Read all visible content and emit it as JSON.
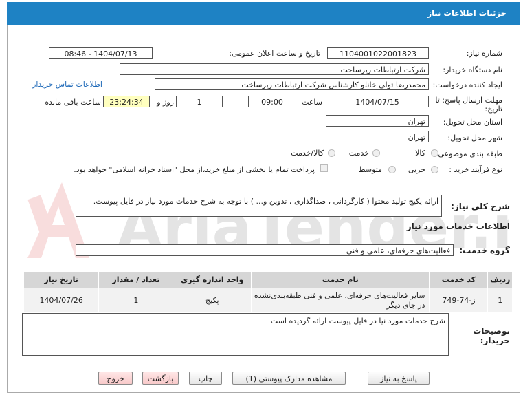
{
  "window_title": "جزئیات اطلاعات نیاز",
  "form": {
    "need_number_label": "شماره نیاز:",
    "need_number": "1104001022001823",
    "announce_label": "تاریخ و ساعت اعلان عمومی:",
    "announce_value": "1404/07/13 - 08:46",
    "buyer_org_label": "نام دستگاه خریدار:",
    "buyer_org": "شرکت ارتباطات زیرساخت",
    "creator_label": "ایجاد کننده درخواست:",
    "creator": "محمدرضا تولی خانلو کارشناس شرکت ارتباطات زیرساخت",
    "contact_link": "اطلاعات تماس خریدار",
    "deadline_label_1": "مهلت ارسال پاسخ: تا",
    "deadline_label_2": "تاریخ:",
    "deadline_date": "1404/07/15",
    "time_label": "ساعت",
    "deadline_time": "09:00",
    "days_value": "1",
    "days_label": "روز و",
    "remaining_time": "23:24:34",
    "remaining_label": "ساعت باقی مانده",
    "province_label": "استان محل تحویل:",
    "province": "تهران",
    "city_label": "شهر محل تحویل:",
    "city": "تهران",
    "category_label": "طبقه بندی موضوعی:",
    "category_options": [
      "کالا",
      "خدمت",
      "کالا/خدمت"
    ],
    "process_label": "نوع فرآیند خرید :",
    "process_options": [
      "جزیی",
      "متوسط"
    ],
    "payment_note": "پرداخت تمام یا بخشی از مبلغ خرید،از محل \"اسناد خزانه اسلامی\" خواهد بود."
  },
  "description": {
    "label": "شرح کلی نیاز:",
    "text": "ارائه پکیج تولید محتوا ( کارگردانی ، صداگذاری ، تدوین و... ) با توجه به شرح خدمات مورد نیاز در فایل پیوست."
  },
  "services": {
    "section_title": "اطلاعات خدمات مورد نیاز",
    "group_label": "گروه خدمت:",
    "group_value": "فعالیت‌های حرفه‌ای، علمی و فنی",
    "headers": [
      "ردیف",
      "کد خدمت",
      "نام خدمت",
      "واحد اندازه گیری",
      "تعداد / مقدار",
      "تاریخ نیاز"
    ],
    "rows": [
      [
        "1",
        "ز-74-749",
        "سایر فعالیت‌های حرفه‌ای، علمی و فنی طبقه‌بندی‌نشده در جای دیگر",
        "پکیج",
        "1",
        "1404/07/26"
      ]
    ]
  },
  "buyer_notes": {
    "label_1": "توضیحات",
    "label_2": "خریدار:",
    "text": "شرح خدمات مورد نیا در فایل پیوست ارائه گردیده است"
  },
  "buttons": {
    "reply": "پاسخ به نیاز",
    "attachments": "مشاهده مدارک پیوستی (1)",
    "print": "چاپ",
    "back": "بازگشت",
    "exit": "خروج"
  },
  "watermark_text": "AriaTender.net"
}
